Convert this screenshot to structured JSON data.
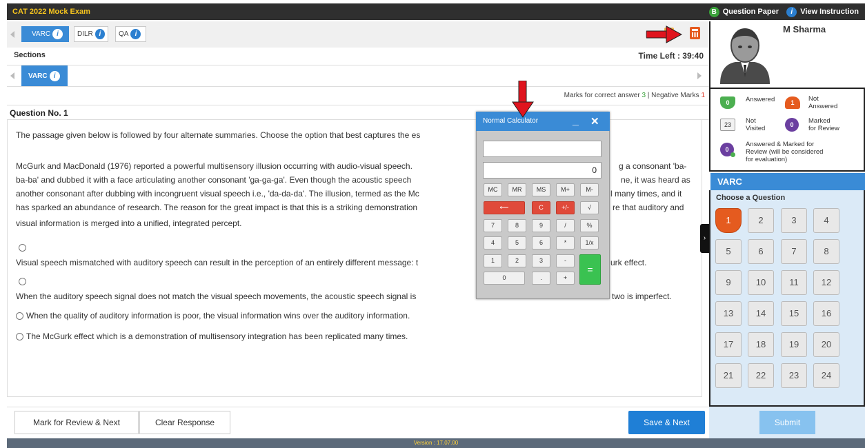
{
  "app": {
    "title": "CAT 2022 Mock Exam",
    "question_paper": "Question Paper",
    "view_instruction": "View Instruction",
    "version": "Version : 17.07.00"
  },
  "sections": {
    "tabs": [
      "VARC",
      "DILR",
      "QA"
    ],
    "label": "Sections",
    "active": "VARC",
    "time_left": "Time Left : 39:40"
  },
  "marks": {
    "prefix": "Marks for correct answer",
    "correct": "3",
    "sep": " | Negative Marks",
    "negative": "1"
  },
  "question": {
    "number": "Question No. 1",
    "instruction": "The passage given below is followed by four alternate summaries. Choose the option that best captures the es",
    "passage_lines": [
      "McGurk and MacDonald (1976) reported a powerful multisensory illusion occurring with audio-visual speech.",
      "ba-ba' and dubbed it with a face articulating another consonant 'ga-ga-ga'. Even though the acoustic speech",
      "another consonant after dubbing with incongruent visual speech i.e., 'da-da-da'. The illusion, termed as the Mc",
      "has sparked an abundance of research. The reason for the great impact is that this is a striking demonstration",
      "visual information is merged into a unified, integrated percept."
    ],
    "passage_right": [
      "g a consonant 'ba-",
      "ne, it was heard as",
      "l many times, and it",
      "re that auditory and"
    ],
    "options": [
      {
        "left": "Visual speech mismatched with auditory speech can result in the perception of an entirely different message: t",
        "right": "urk effect."
      },
      {
        "left": "When the auditory speech signal does not match the visual speech movements, the acoustic speech signal is",
        "right": "two is imperfect."
      },
      {
        "left": "When the quality of auditory information is poor, the visual information wins over the auditory information.",
        "right": ""
      },
      {
        "left": "The McGurk effect which is a demonstration of multisensory integration has been replicated many times.",
        "right": ""
      }
    ]
  },
  "calculator": {
    "title": "Normal Calculator",
    "minimize": "_",
    "close": "✕",
    "display_top": "",
    "display_value": "0",
    "keys": {
      "mc": "MC",
      "mr": "MR",
      "ms": "MS",
      "mplus": "M+",
      "mminus": "M-",
      "back": "⟵",
      "c": "C",
      "pm": "+/-",
      "sqrt": "√",
      "k7": "7",
      "k8": "8",
      "k9": "9",
      "div": "/",
      "pct": "%",
      "k4": "4",
      "k5": "5",
      "k6": "6",
      "mul": "*",
      "inv": "1/x",
      "k1": "1",
      "k2": "2",
      "k3": "3",
      "sub": "-",
      "eq": "=",
      "k0": "0",
      "dot": ".",
      "add": "+"
    }
  },
  "user": {
    "name": "M Sharma"
  },
  "legend": {
    "answered": "Answered",
    "answered_count": "0",
    "not_answered_l1": "Not",
    "not_answered_l2": "Answered",
    "not_answered_count": "1",
    "not_visited_l1": "Not",
    "not_visited_l2": "Visited",
    "not_visited_count": "23",
    "marked_l1": "Marked",
    "marked_l2": "for Review",
    "marked_count": "0",
    "ans_marked_l1": "Answered & Marked for",
    "ans_marked_l2": "Review (will be considered",
    "ans_marked_l3": "for evaluation)",
    "ans_marked_count": "0"
  },
  "palette": {
    "section": "VARC",
    "choose": "Choose a Question",
    "questions": [
      "1",
      "2",
      "3",
      "4",
      "5",
      "6",
      "7",
      "8",
      "9",
      "10",
      "11",
      "12",
      "13",
      "14",
      "15",
      "16",
      "17",
      "18",
      "19",
      "20",
      "21",
      "22",
      "23",
      "24"
    ]
  },
  "buttons": {
    "mark_review": "Mark for Review & Next",
    "clear": "Clear Response",
    "save_next": "Save & Next",
    "submit": "Submit"
  },
  "colors": {
    "accent": "#3a8bd6",
    "not_answered": "#e55b1f",
    "answered": "#4caf50",
    "marked": "#6b3fa0",
    "annotation_arrow": "#e0141e"
  }
}
